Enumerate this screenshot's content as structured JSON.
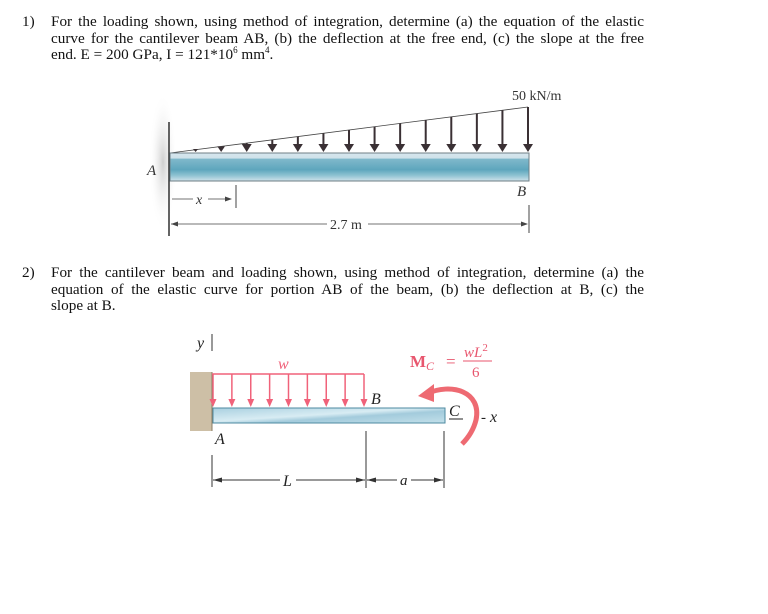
{
  "problems": [
    {
      "number": "1)",
      "lines": [
        "For the loading shown, using method of integration, determine (a) the equation of the elastic",
        "curve for the cantilever beam AB, (b) the deflection at the free end, (c) the slope at the free"
      ],
      "last_line_prefix": "end. E = 200 GPa, I = 121*10",
      "exp1": "6",
      "mid": " mm",
      "exp2": "4",
      "end": ".",
      "figure": {
        "load_label": "50 kN/m",
        "label_A": "A",
        "label_B": "B",
        "label_x": "x",
        "length_label": "2.7 m",
        "beam_color": "#6aaec4",
        "arrow_color": "#3a3034"
      }
    },
    {
      "number": "2)",
      "lines": [
        "For the cantilever beam and loading shown, using method of integration, determine (a) the",
        "equation of the elastic curve for portion AB of the beam, (b) the deflection at B, (c) the",
        "slope at B."
      ],
      "figure": {
        "label_y": "y",
        "label_w": "w",
        "label_A": "A",
        "label_B": "B",
        "label_C": "C",
        "label_x": "x",
        "label_L": "L",
        "label_a": "a",
        "moment_label": "M",
        "moment_sub": "C",
        "moment_eq": "=",
        "moment_num": "wL",
        "moment_num_exp": "2",
        "moment_den": "6",
        "load_color": "#f0627a",
        "moment_color": "#ee6a72",
        "wall_color": "#cdbfa6"
      }
    }
  ]
}
